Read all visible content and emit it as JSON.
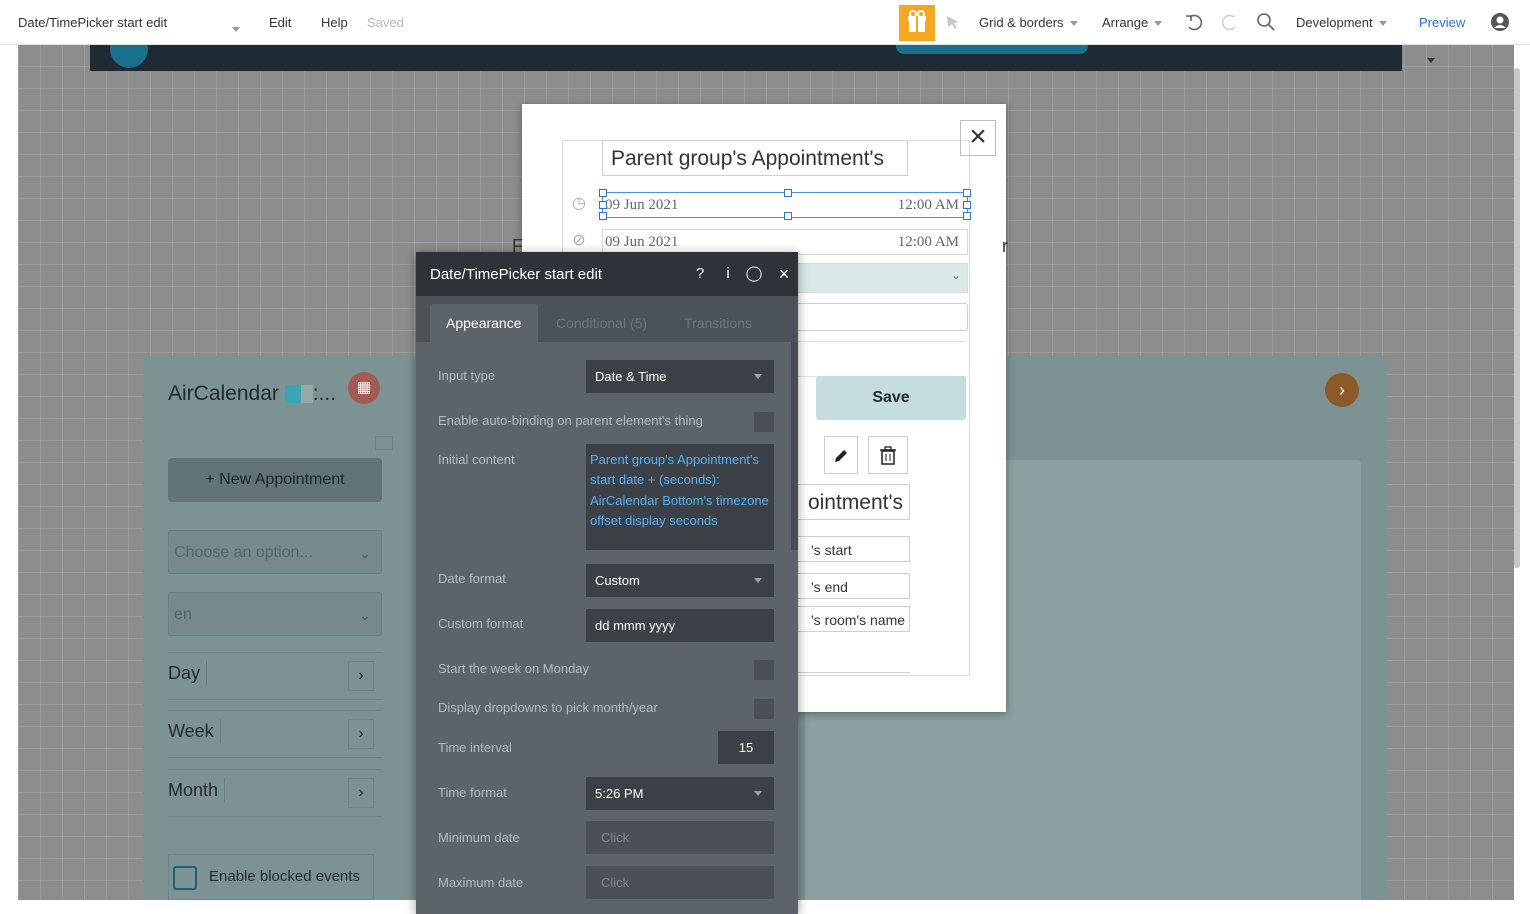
{
  "topbar": {
    "page_name": "Date/TimePicker start edit",
    "menu_edit": "Edit",
    "menu_help": "Help",
    "save_status": "Saved",
    "gift_icon": "gift-icon",
    "grid_borders": "Grid & borders",
    "arrange": "Arrange",
    "environment": "Development",
    "preview": "Preview",
    "accent_color": "#f5a623"
  },
  "calendar": {
    "title": "AirCalendar",
    "title_suffix": ":...",
    "new_appointment": "+ New Appointment",
    "choose_placeholder": "Choose an option...",
    "language": "en",
    "views": [
      "Day",
      "Week",
      "Month"
    ],
    "enable_blocked": "Enable blocked events"
  },
  "popup": {
    "title": "Parent group's Appointment's",
    "start_date": "09 Jun 2021",
    "start_time": "12:00 AM",
    "end_date": "09 Jun 2021",
    "end_time": "12:00 AM",
    "save": "Save",
    "title_fragment": "ointment's",
    "frag_start": "'s start",
    "frag_end": "'s end",
    "frag_room": "'s room's name",
    "stray_left": "F",
    "stray_right": "r"
  },
  "editor": {
    "title": "Date/TimePicker start edit",
    "tabs": [
      "Appearance",
      "Conditional (5)",
      "Transitions"
    ],
    "active_tab": "Appearance",
    "props": {
      "input_type_label": "Input type",
      "input_type_value": "Date & Time",
      "auto_binding_label": "Enable auto-binding on parent element's thing",
      "initial_content_label": "Initial content",
      "initial_content_value": "Parent group's Appointment's start date + (seconds): AirCalendar Bottom's timezone offset display seconds",
      "date_format_label": "Date format",
      "date_format_value": "Custom",
      "custom_format_label": "Custom format",
      "custom_format_value": "dd mmm yyyy",
      "week_monday_label": "Start the week on Monday",
      "dropdowns_label": "Display dropdowns to pick month/year",
      "time_interval_label": "Time interval",
      "time_interval_value": "15",
      "time_format_label": "Time format",
      "time_format_value": "5:26 PM",
      "min_date_label": "Minimum date",
      "min_date_value": "Click",
      "max_date_label": "Maximum date",
      "max_date_value": "Click"
    },
    "link_color": "#57b1f5"
  }
}
